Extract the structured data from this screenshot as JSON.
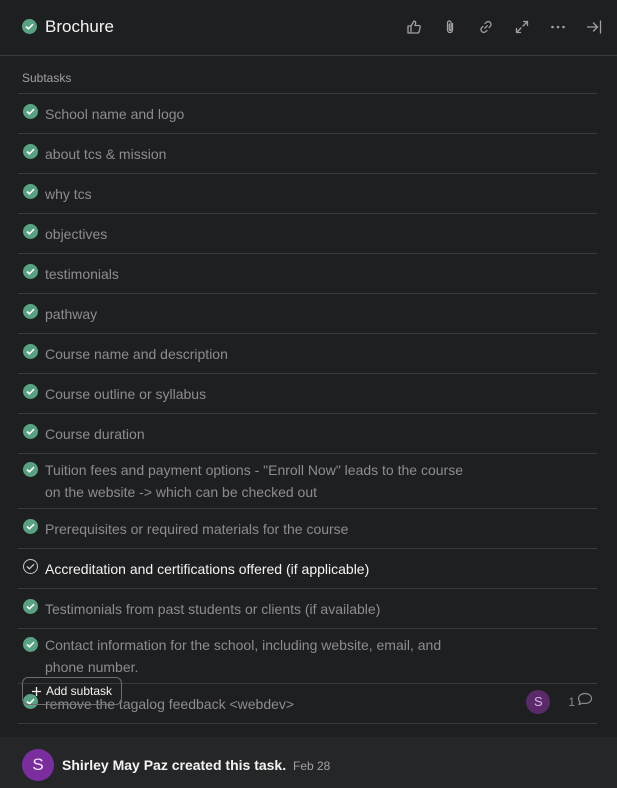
{
  "task": {
    "title": "Brochure",
    "completed": true
  },
  "toolbar": {
    "icons": [
      "thumbs-up-icon",
      "paperclip-icon",
      "link-icon",
      "expand-icon",
      "more-icon",
      "close-panel-icon"
    ]
  },
  "subtasks": {
    "section_label": "Subtasks",
    "items": [
      {
        "line1": "School name and logo",
        "line2": "",
        "done": true
      },
      {
        "line1": "about tcs & mission",
        "line2": "",
        "done": true
      },
      {
        "line1": "why tcs",
        "line2": "",
        "done": true
      },
      {
        "line1": "objectives",
        "line2": "",
        "done": true
      },
      {
        "line1": "testimonials",
        "line2": "",
        "done": true
      },
      {
        "line1": "pathway",
        "line2": "",
        "done": true
      },
      {
        "line1": "Course name and description",
        "line2": "",
        "done": true
      },
      {
        "line1": "Course outline or syllabus",
        "line2": "",
        "done": true
      },
      {
        "line1": "Course duration",
        "line2": "",
        "done": true
      },
      {
        "line1": "Tuition fees and payment options - \"Enroll Now\" leads to the course",
        "line2": "on the website -> which can be checked out",
        "done": true
      },
      {
        "line1": "Prerequisites or required materials for the course",
        "line2": "",
        "done": true
      },
      {
        "line1": "Accreditation and certifications offered (if applicable)",
        "line2": "",
        "done": false
      },
      {
        "line1": "Testimonials from past students or clients (if available)",
        "line2": "",
        "done": true
      },
      {
        "line1": "Contact information for the school, including website, email, and",
        "line2": "phone number.",
        "done": true
      },
      {
        "line1": "remove the tagalog feedback <webdev>",
        "line2": "",
        "done": true,
        "assignee_initial": "S",
        "comment_count": "1"
      }
    ],
    "add_label": "Add subtask"
  },
  "activity": {
    "avatar_initial": "S",
    "text": "Shirley May Paz created this task.",
    "date": "Feb 28"
  },
  "colors": {
    "background": "#1e1f21",
    "done_check": "#58a182",
    "avatar_purple": "#7a2e9e"
  }
}
